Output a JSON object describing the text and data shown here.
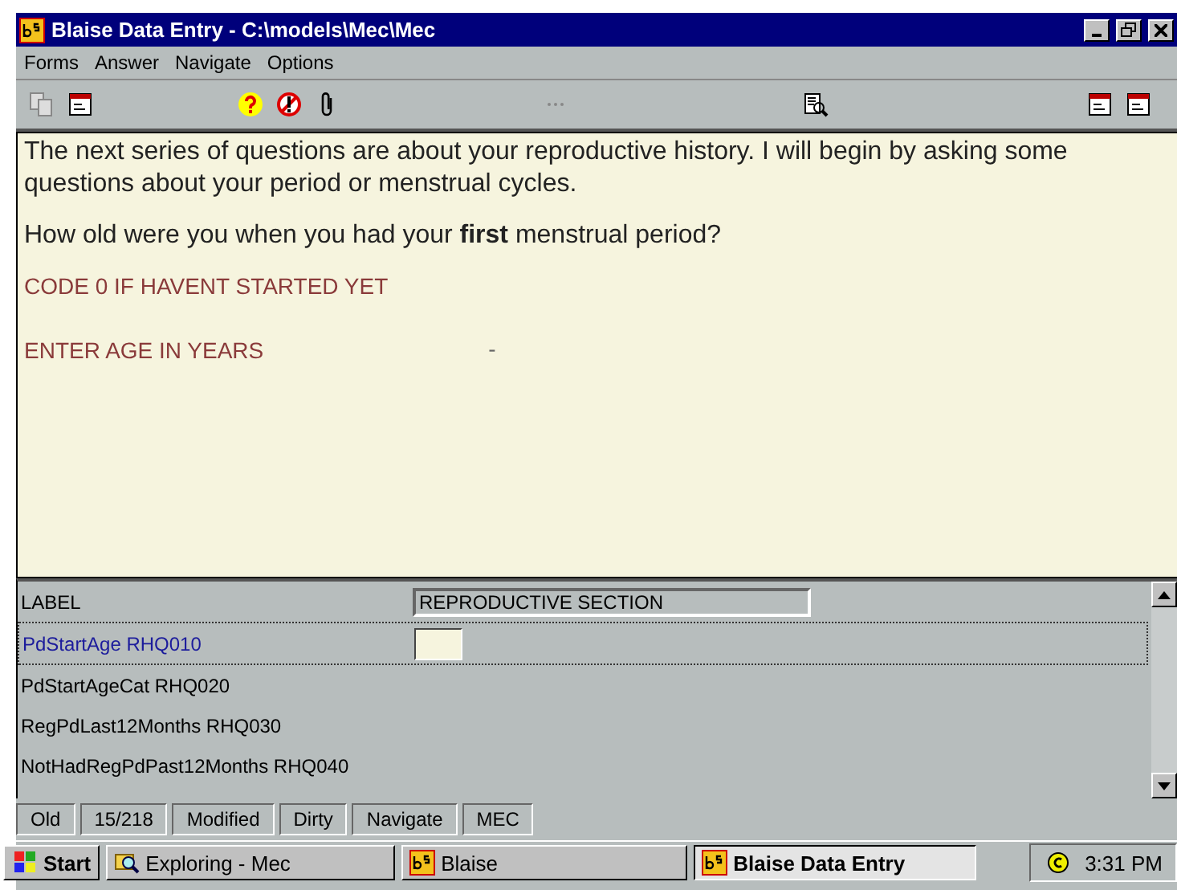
{
  "window": {
    "title": "Blaise Data Entry - C:\\models\\Mec\\Mec"
  },
  "menu": [
    "Forms",
    "Answer",
    "Navigate",
    "Options"
  ],
  "question": {
    "intro": "The next series of questions are about your reproductive history. I will begin by asking some questions about your period or menstrual cycles.",
    "prompt": "How old were you when you had your **first** menstrual period?",
    "instructions": [
      "CODE 0 IF HAVENT STARTED YET",
      "ENTER AGE IN YEARS"
    ],
    "marker": "-"
  },
  "grid": {
    "label_row": {
      "label": "LABEL",
      "value": "REPRODUCTIVE SECTION"
    },
    "rows": [
      {
        "label": "PdStartAge RHQ010",
        "selected": true
      },
      {
        "label": "PdStartAgeCat RHQ020",
        "selected": false
      },
      {
        "label": "RegPdLast12Months RHQ030",
        "selected": false
      },
      {
        "label": "NotHadRegPdPast12Months RHQ040",
        "selected": false
      }
    ]
  },
  "status_bar": [
    "Old",
    "15/218",
    "Modified",
    "Dirty",
    "Navigate",
    "MEC"
  ],
  "taskbar": {
    "start": "Start",
    "tasks": [
      {
        "label": "Exploring - Mec",
        "selected": false,
        "kind": "explorer"
      },
      {
        "label": "Blaise",
        "selected": false,
        "kind": "blaise"
      },
      {
        "label": "Blaise Data Entry",
        "selected": true,
        "kind": "blaise"
      }
    ],
    "time": "3:31 PM"
  }
}
